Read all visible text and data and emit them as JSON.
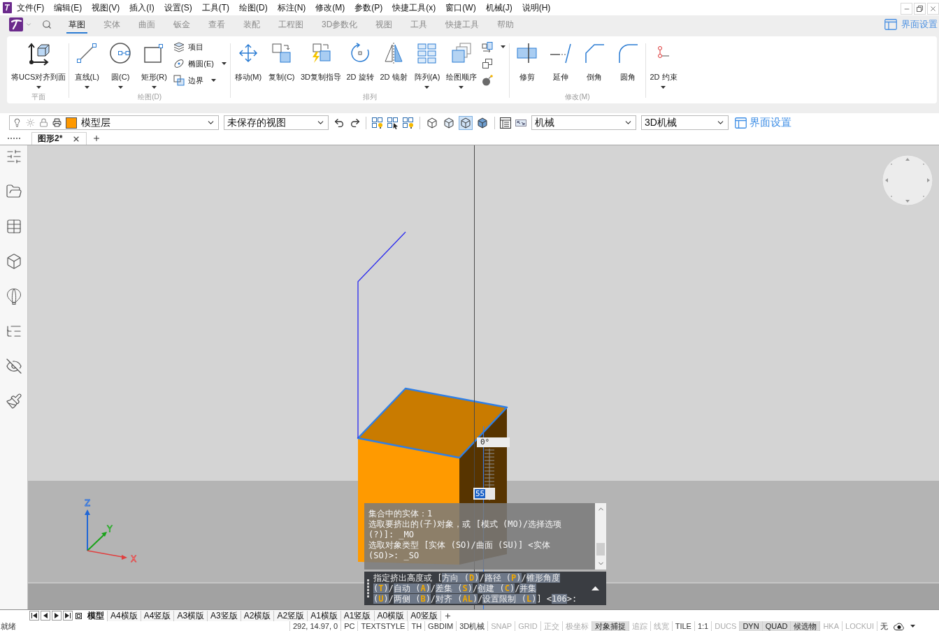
{
  "menu_bar": {
    "items": [
      "文件(F)",
      "编辑(E)",
      "视图(V)",
      "插入(I)",
      "设置(S)",
      "工具(T)",
      "绘图(D)",
      "标注(N)",
      "修改(M)",
      "参数(P)",
      "快捷工具(x)",
      "窗口(W)",
      "机械(J)",
      "说明(H)"
    ]
  },
  "ribbon": {
    "tabs": [
      {
        "label": "草图",
        "selected": true
      },
      {
        "label": "实体",
        "selected": false
      },
      {
        "label": "曲面",
        "selected": false
      },
      {
        "label": "钣金",
        "selected": false
      },
      {
        "label": "查看",
        "selected": false
      },
      {
        "label": "装配",
        "selected": false
      },
      {
        "label": "工程图",
        "selected": false
      },
      {
        "label": "3D参数化",
        "selected": false
      },
      {
        "label": "视图",
        "selected": false
      },
      {
        "label": "工具",
        "selected": false
      },
      {
        "label": "快捷工具",
        "selected": false
      },
      {
        "label": "帮助",
        "selected": false
      }
    ],
    "settings_link": "界面设置",
    "groups": [
      {
        "title": "平面",
        "buttons": [
          {
            "kind": "large",
            "label": "将UCS对齐到面",
            "dropdown": true
          }
        ]
      },
      {
        "title": "绘图(D)",
        "buttons": [
          {
            "kind": "large",
            "label": "直线(L)",
            "dropdown": true
          },
          {
            "kind": "large",
            "label": "圆(C)",
            "dropdown": true
          },
          {
            "kind": "large",
            "label": "矩形(R)",
            "dropdown": true
          },
          {
            "kind": "small",
            "label": "项目",
            "dropdown": false
          },
          {
            "kind": "small",
            "label": "椭圆(E)",
            "dropdown": true
          },
          {
            "kind": "small",
            "label": "边界",
            "dropdown": true
          }
        ]
      },
      {
        "title": "排列",
        "buttons": [
          {
            "kind": "large",
            "label": "移动(M)",
            "dropdown": false
          },
          {
            "kind": "large",
            "label": "复制(C)",
            "dropdown": false
          },
          {
            "kind": "large",
            "label": "3D复制指导",
            "dropdown": false
          },
          {
            "kind": "large",
            "label": "2D 旋转",
            "dropdown": false
          },
          {
            "kind": "large",
            "label": "2D 镜射",
            "dropdown": false
          },
          {
            "kind": "large",
            "label": "阵列(A)",
            "dropdown": true
          },
          {
            "kind": "large",
            "label": "绘图顺序",
            "dropdown": true
          },
          {
            "kind": "icon",
            "dropdown": true
          },
          {
            "kind": "icon",
            "dropdown": false
          },
          {
            "kind": "icon",
            "dropdown": false
          }
        ]
      },
      {
        "title": "修改(M)",
        "buttons": [
          {
            "kind": "large",
            "label": "修剪",
            "dropdown": false
          },
          {
            "kind": "large",
            "label": "延伸",
            "dropdown": false
          },
          {
            "kind": "large",
            "label": "倒角",
            "dropdown": false
          },
          {
            "kind": "large",
            "label": "圆角",
            "dropdown": false
          }
        ]
      },
      {
        "buttons": [
          {
            "kind": "large",
            "label": "2D 约束",
            "dropdown": true
          }
        ]
      }
    ]
  },
  "toolbar": {
    "layer": {
      "value": "模型层"
    },
    "named_view": {
      "value": "未保存的视图"
    },
    "visual_styles": [
      {
        "selected": false
      },
      {
        "selected": false
      },
      {
        "selected": true
      },
      {
        "selected": false
      }
    ],
    "workspace": {
      "value": "机械"
    },
    "profile": {
      "value": "3D机械"
    },
    "settings_link": "界面设置"
  },
  "document_tabs": [
    {
      "label": "图形2*",
      "selected": true
    }
  ],
  "viewport": {
    "angle_readout": "0°",
    "dimension_input": "55",
    "ucs_labels": {
      "x": "X",
      "y": "Y",
      "z": "Z"
    }
  },
  "command_window": {
    "history": [
      "集合中的实体：1",
      "选取要挤出的(子)对象，或 [模式 (MO)/选择选项",
      "(?)]: _MO",
      "选取对象类型 [实体 (SO)/曲面 (SU)] <实体",
      "(SO)>: _SO"
    ],
    "prompt": [
      [
        {
          "kind": "plain",
          "text": "指定挤出高度或 ["
        },
        {
          "kind": "option",
          "text": "方向 (**D**)"
        },
        {
          "kind": "plain",
          "text": "/"
        },
        {
          "kind": "option",
          "text": "路径 (**P**)"
        },
        {
          "kind": "plain",
          "text": "/"
        },
        {
          "kind": "option",
          "text": "锥形角度"
        }
      ],
      [
        {
          "kind": "option",
          "text": "(**T**)"
        },
        {
          "kind": "plain",
          "text": "/"
        },
        {
          "kind": "option",
          "text": "自动 (**A**)"
        },
        {
          "kind": "plain",
          "text": "/"
        },
        {
          "kind": "option",
          "text": "差集 (**S**)"
        },
        {
          "kind": "plain",
          "text": "/"
        },
        {
          "kind": "option",
          "text": "创建 (**C**)"
        },
        {
          "kind": "plain",
          "text": "/"
        },
        {
          "kind": "option",
          "text": "并集"
        }
      ],
      [
        {
          "kind": "option",
          "text": "(**U**)"
        },
        {
          "kind": "plain",
          "text": "/"
        },
        {
          "kind": "option",
          "text": "两侧 (**B**)"
        },
        {
          "kind": "plain",
          "text": "/"
        },
        {
          "kind": "option",
          "text": "对齐 (**AL**)"
        },
        {
          "kind": "plain",
          "text": "/"
        },
        {
          "kind": "option",
          "text": "设置限制 (**L**)"
        },
        {
          "kind": "plain",
          "text": "] <"
        },
        {
          "kind": "option",
          "text": "106"
        },
        {
          "kind": "plain",
          "text": ">:"
        }
      ]
    ]
  },
  "layout_tabs": [
    {
      "label": "模型",
      "selected": true
    },
    {
      "label": "A4横版",
      "selected": false
    },
    {
      "label": "A4竖版",
      "selected": false
    },
    {
      "label": "A3横版",
      "selected": false
    },
    {
      "label": "A3竖版",
      "selected": false
    },
    {
      "label": "A2横版",
      "selected": false
    },
    {
      "label": "A2竖版",
      "selected": false
    },
    {
      "label": "A1横版",
      "selected": false
    },
    {
      "label": "A1竖版",
      "selected": false
    },
    {
      "label": "A0横版",
      "selected": false
    },
    {
      "label": "A0竖版",
      "selected": false
    }
  ],
  "status_bar": {
    "message": "就绪",
    "coordinates": "292, 14.97, 0",
    "items": [
      {
        "kind": "text",
        "label": "PC"
      },
      {
        "kind": "text",
        "label": "TEXTSTYLE"
      },
      {
        "kind": "text",
        "label": "TH"
      },
      {
        "kind": "text",
        "label": "GBDIM"
      },
      {
        "kind": "text",
        "label": "3D机械"
      },
      {
        "kind": "toggle",
        "label": "SNAP",
        "on": false
      },
      {
        "kind": "toggle",
        "label": "GRID",
        "on": false
      },
      {
        "kind": "toggle",
        "label": "正交",
        "on": false
      },
      {
        "kind": "toggle",
        "label": "极坐标",
        "on": false
      },
      {
        "kind": "toggle",
        "label": "对象捕捉",
        "on": true
      },
      {
        "kind": "toggle",
        "label": "追踪",
        "on": false
      },
      {
        "kind": "toggle",
        "label": "线宽",
        "on": false
      },
      {
        "kind": "text",
        "label": "TILE"
      },
      {
        "kind": "text",
        "label": "1:1"
      },
      {
        "kind": "toggle",
        "label": "DUCS",
        "on": false
      },
      {
        "kind": "toggle",
        "label": "DYN",
        "on": true
      },
      {
        "kind": "toggle",
        "label": "QUAD",
        "on": true
      },
      {
        "kind": "toggle",
        "label": "候选物",
        "on": true
      },
      {
        "kind": "toggle",
        "label": "HKA",
        "on": false
      },
      {
        "kind": "toggle",
        "label": "LOCKUI",
        "on": false
      },
      {
        "kind": "text",
        "label": "无"
      }
    ]
  }
}
